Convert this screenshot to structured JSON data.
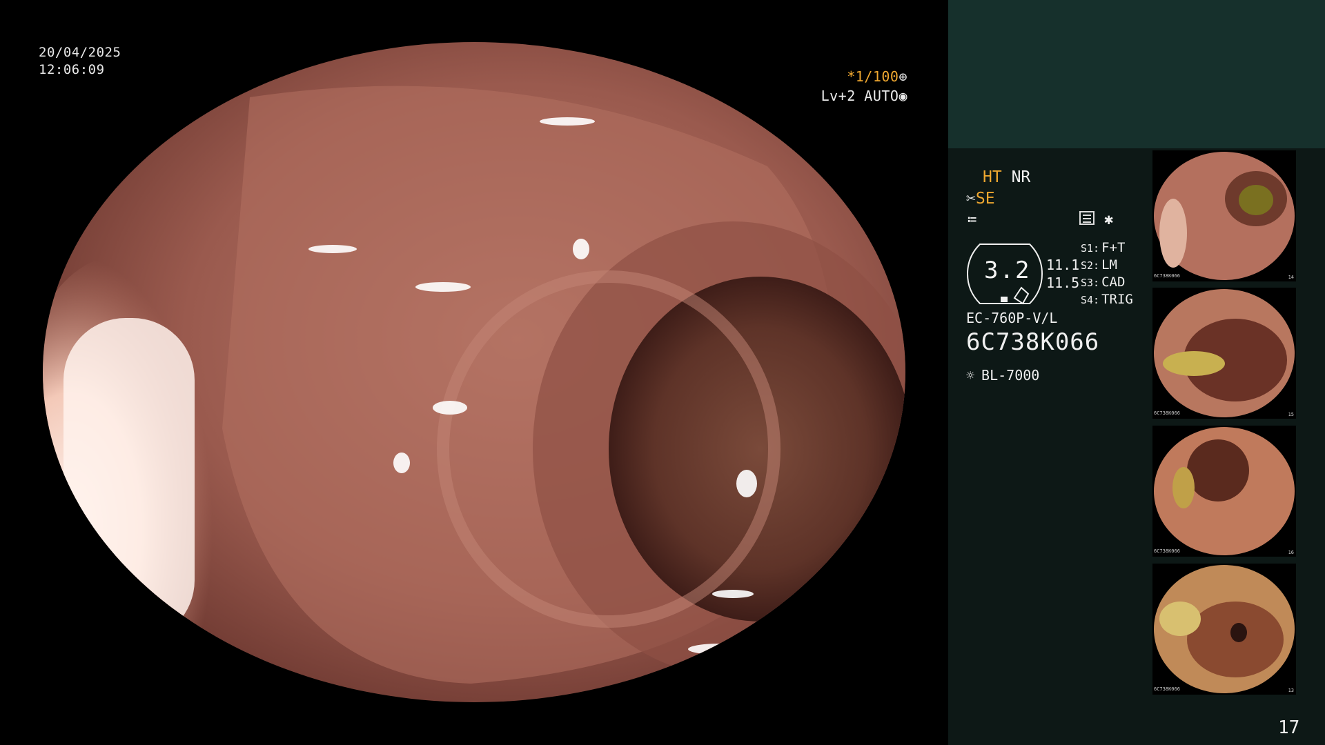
{
  "overlay": {
    "date": "20/04/2025",
    "time": "12:06:09",
    "zoom": "*1/100",
    "level": "Lv+2 AUTO"
  },
  "panel": {
    "ht": "HT",
    "nr": "NR",
    "se": "SE",
    "gauge_value": "3.2",
    "value_1": "11.1",
    "value_2": "11.5",
    "settings": [
      {
        "key": "S1:",
        "value": "F+T"
      },
      {
        "key": "S2:",
        "value": "LM"
      },
      {
        "key": "S3:",
        "value": "CAD"
      },
      {
        "key": "S4:",
        "value": "TRIG"
      }
    ],
    "model": "EC-760P-V/L",
    "serial": "6C738K066",
    "light_source": "BL-7000",
    "page_number": "17"
  },
  "thumbnails": [
    {
      "id": "6C738K066",
      "number": "14"
    },
    {
      "id": "6C738K066",
      "number": "15"
    },
    {
      "id": "6C738K066",
      "number": "16"
    },
    {
      "id": "6C738K066",
      "number": "13"
    }
  ],
  "colors": {
    "accent_orange": "#f0a830",
    "panel_bg": "#0d1816",
    "panel_header": "#16302c",
    "tissue": "#a8665a"
  },
  "icons": [
    "scissors-icon",
    "menu-icon",
    "star-icon",
    "lamp-icon",
    "settings-icon",
    "fan-icon"
  ]
}
